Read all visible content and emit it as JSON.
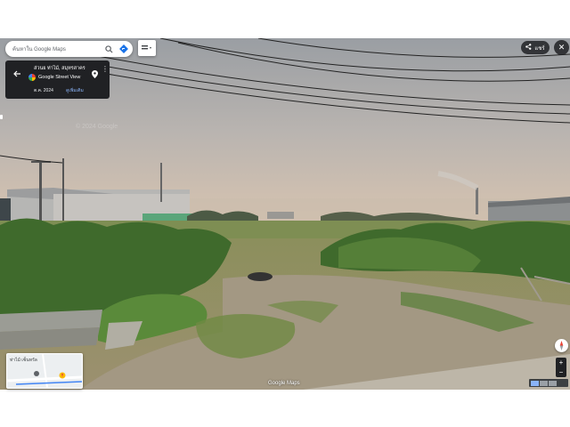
{
  "search": {
    "placeholder": "ค้นหาใน Google Maps"
  },
  "info_card": {
    "place_name": "ส่วนย ท่าไม้, สมุทรสาคร",
    "source": "Google Street View",
    "date": "ต.ค. 2024",
    "see_more": "ดูเพิ่มเติม"
  },
  "share": {
    "label": "แชร์"
  },
  "watermark": "© 2024 Google",
  "minimap": {
    "label": "ท่าไม้ เซ็นทรัล"
  },
  "attribution": "Google Maps",
  "zoom": {
    "plus": "+",
    "minus": "−"
  },
  "icons": {
    "search": "search-icon",
    "directions": "directions-icon",
    "layers": "layers-icon",
    "back": "back-arrow-icon",
    "pin": "location-pin-icon",
    "more": "more-vert-icon",
    "share": "share-icon",
    "close": "close-icon",
    "compass": "compass-icon"
  },
  "colors": {
    "card_bg": "#202124",
    "link": "#8ab4f8",
    "directions": "#1a73e8"
  }
}
